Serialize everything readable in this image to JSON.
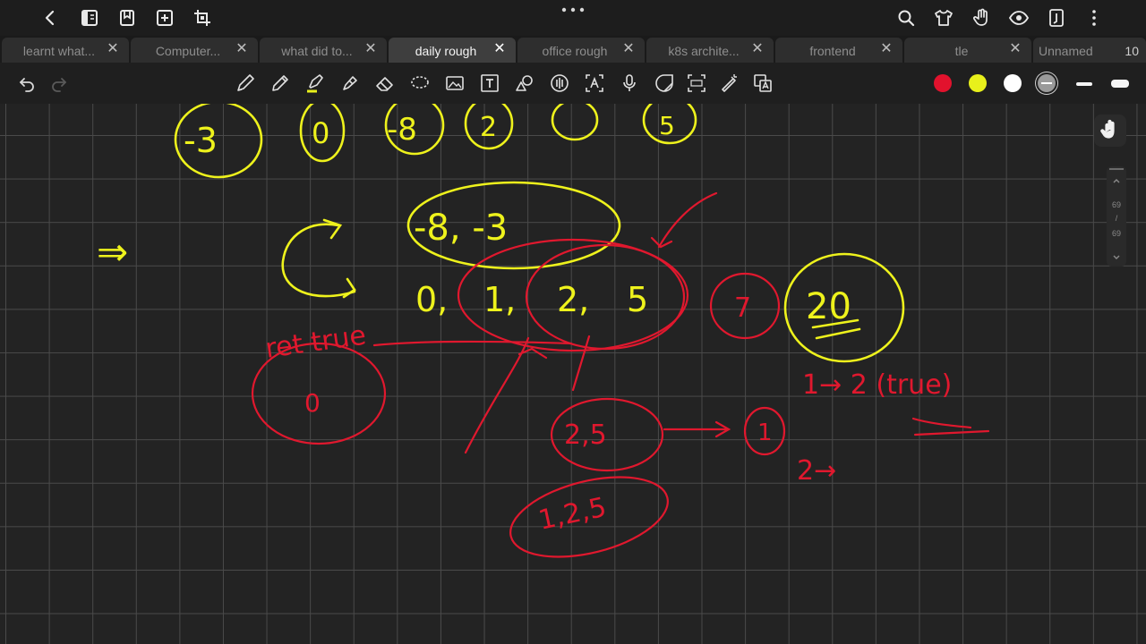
{
  "tabs": [
    {
      "label": "learnt what...",
      "close": "✕"
    },
    {
      "label": "Computer...",
      "close": "✕"
    },
    {
      "label": "what did to...",
      "close": "✕"
    },
    {
      "label": "daily rough",
      "close": "✕"
    },
    {
      "label": "office rough",
      "close": "✕"
    },
    {
      "label": "k8s archite...",
      "close": "✕"
    },
    {
      "label": "frontend",
      "close": "✕"
    },
    {
      "label": "tle",
      "close": "✕"
    },
    {
      "label": "Unnamed",
      "count": "10"
    }
  ],
  "active_tab_index": 3,
  "colors": {
    "red": "#e2122d",
    "yellow": "#e8f01b",
    "white": "#ffffff",
    "gray": "#9a9a9a",
    "ink_yellow": "#eef21c",
    "ink_red": "#e0182e"
  },
  "pager": {
    "current": "69",
    "separator": "/",
    "total": "69"
  },
  "notes": {
    "y_top": [
      "-3",
      "0",
      "-8",
      "2",
      "5"
    ],
    "y_pair": "-8, -3",
    "y_arrow": "⇒",
    "y_row": [
      "0,",
      "1,",
      "2,",
      "5"
    ],
    "y_result": "20",
    "r_seven": "7",
    "r_ret": "ret true",
    "r_zero": "0",
    "r_step1": "1→ 2 (true)",
    "r_two_five": "2,5",
    "r_one": "1",
    "r_step2": "2→",
    "r_triple": "1,2,5"
  },
  "icons": {
    "top_left": [
      "back-icon",
      "sidebar-icon",
      "bookmark-icon",
      "add-page-icon",
      "crop-icon"
    ],
    "top_right": [
      "search-icon",
      "shirt-icon",
      "hand-touch-icon",
      "eye-icon",
      "page-icon",
      "more-vertical-icon"
    ],
    "tools": [
      "pen-icon",
      "pencil-icon",
      "highlighter-icon",
      "marker-icon",
      "eraser-icon",
      "lasso-icon",
      "image-icon",
      "text-icon",
      "shape-icon",
      "audio-icon",
      "text-recognition-icon",
      "microphone-icon",
      "sticker-icon",
      "ocr-icon",
      "laser-icon",
      "translate-icon"
    ]
  }
}
